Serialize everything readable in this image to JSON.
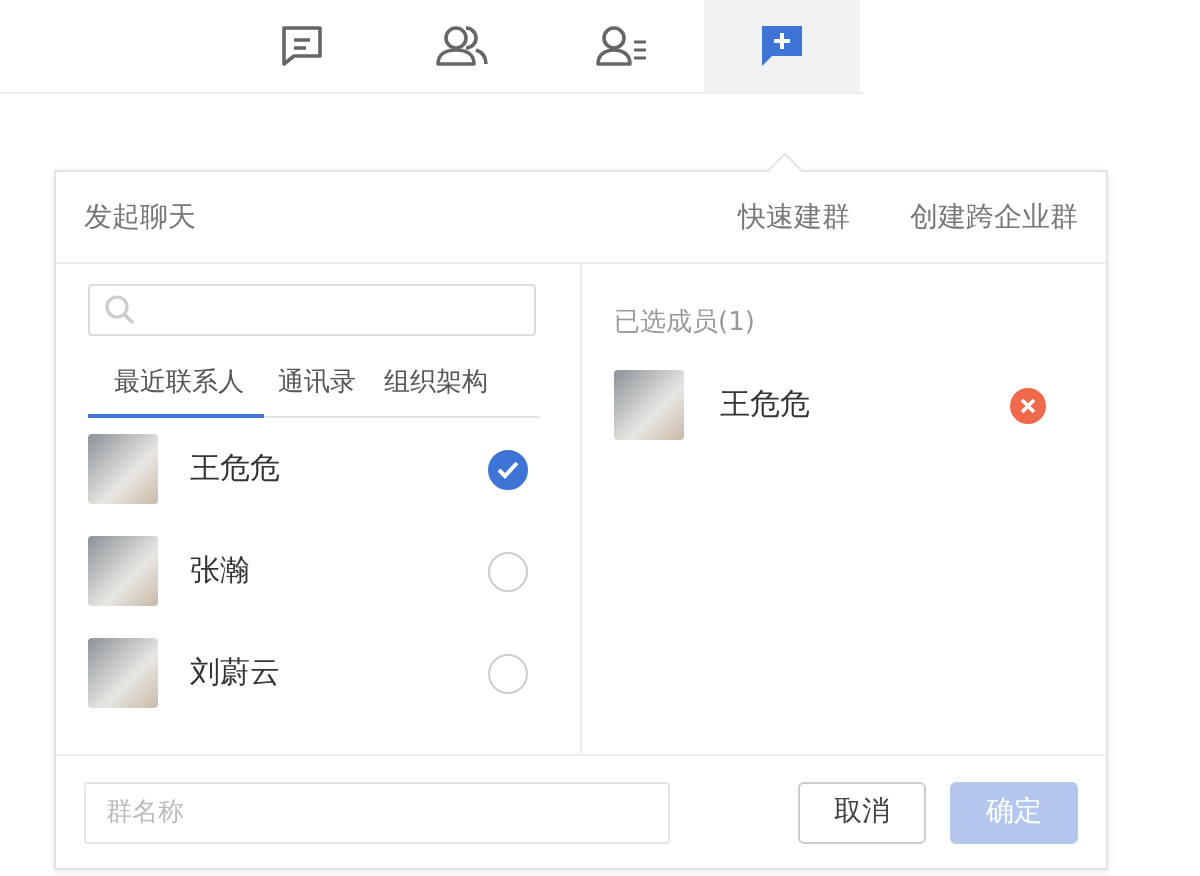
{
  "nav_tabs": [
    {
      "kind": "chat",
      "selected": false
    },
    {
      "kind": "contacts",
      "selected": false
    },
    {
      "kind": "profile-list",
      "selected": false
    },
    {
      "kind": "new-chat",
      "selected": true
    }
  ],
  "dialog": {
    "title": "发起聊天",
    "actions": [
      "快速建群",
      "创建跨企业群"
    ],
    "tabs": [
      {
        "label": "最近联系人",
        "selected": true
      },
      {
        "label": "通讯录",
        "selected": false
      },
      {
        "label": "组织架构",
        "selected": false
      }
    ],
    "contacts": [
      {
        "name": "王危危",
        "checked": true
      },
      {
        "name": "张瀚",
        "checked": false
      },
      {
        "name": "刘蔚云",
        "checked": false
      }
    ],
    "selected_header": "已选成员(1)",
    "selected_members": [
      {
        "name": "王危危"
      }
    ],
    "group_name": {
      "placeholder": "群名称"
    },
    "buttons": [
      {
        "label": "取消",
        "kind": "secondary",
        "disabled": false
      },
      {
        "label": "确定",
        "kind": "primary",
        "disabled": true
      }
    ]
  }
}
